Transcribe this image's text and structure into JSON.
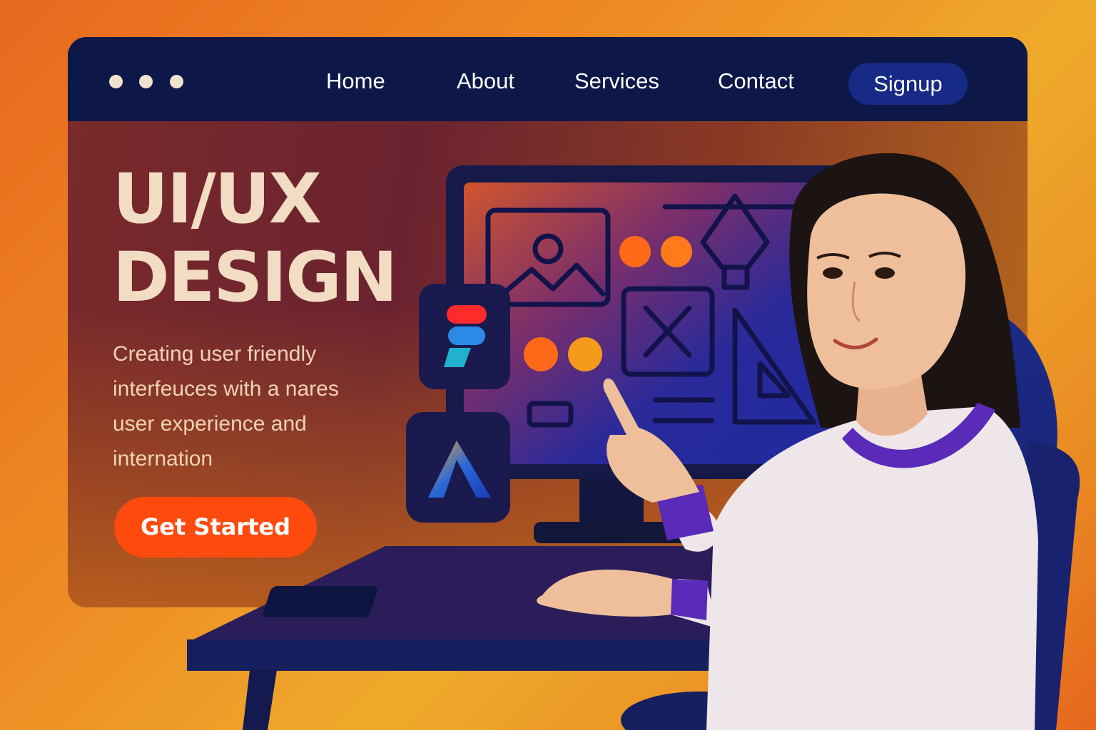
{
  "window": {
    "dots": 3
  },
  "nav": {
    "home": "Home",
    "about": "About",
    "services": "Services",
    "contact": "Contact",
    "signup": "Signup"
  },
  "hero": {
    "title_line1": "UI/UX",
    "title_line2": "DESIGN",
    "desc_line1": "Creating user friendly",
    "desc_line2": "interfeuces with a nares",
    "desc_line3": "user experience and",
    "desc_line4": "internation",
    "cta": "Get Started"
  },
  "app_icons": [
    "figma-like-icon",
    "affinity-like-icon"
  ],
  "colors": {
    "nav_bg": "#0d1848",
    "signup_bg": "#172a86",
    "cta_bg": "#ff4a0e",
    "title": "#f2dcc3",
    "accent_dot": "#ff6a1a"
  }
}
